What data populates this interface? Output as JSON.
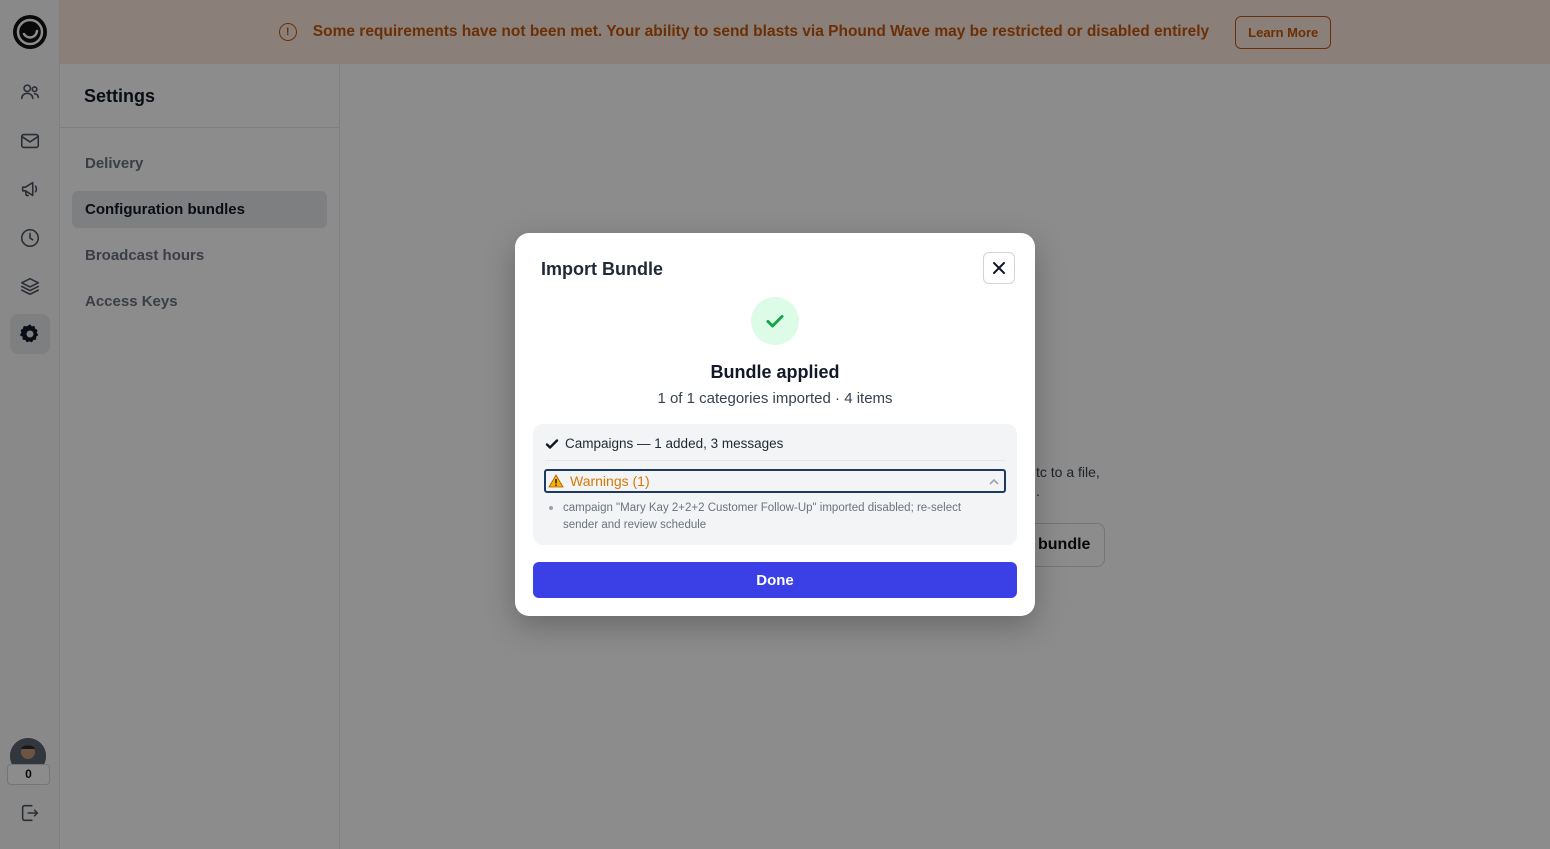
{
  "banner": {
    "message": "Some requirements have not been met. Your ability to send blasts via Phound Wave may be restricted or disabled entirely",
    "alert_glyph": "!",
    "learn_more_label": "Learn More"
  },
  "rail": {
    "items": [
      {
        "icon": "contacts-icon"
      },
      {
        "icon": "mail-icon"
      },
      {
        "icon": "megaphone-icon"
      },
      {
        "icon": "clock-icon"
      },
      {
        "icon": "layers-icon"
      },
      {
        "icon": "gear-icon",
        "active": true
      }
    ],
    "avatar_count": "0"
  },
  "settings": {
    "title": "Settings",
    "nav": [
      {
        "label": "Delivery"
      },
      {
        "label": "Configuration bundles",
        "active": true
      },
      {
        "label": "Broadcast hours"
      },
      {
        "label": "Access Keys"
      }
    ]
  },
  "background": {
    "text_line1": "tc to a file,",
    "text_line2": ".",
    "button_label": "bundle"
  },
  "modal": {
    "title": "Import Bundle",
    "result_title": "Bundle applied",
    "result_subtitle": "1 of 1 categories imported · 4 items",
    "detail_row": "Campaigns — 1 added, 3 messages",
    "warnings_label": "Warnings (1)",
    "warning_item": "campaign \"Mary Kay 2+2+2 Customer Follow-Up\" imported disabled; re-select sender and review schedule",
    "done_label": "Done"
  },
  "colors": {
    "accent": "#3b3fe6",
    "warning": "#c2570c",
    "success": "#16a34a"
  }
}
